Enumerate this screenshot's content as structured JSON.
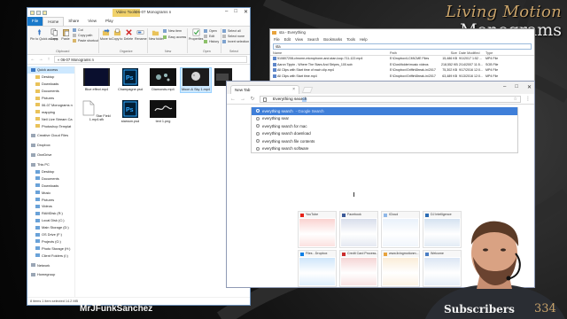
{
  "brand": {
    "top": "Living Motion",
    "bottom": "Monograms"
  },
  "overlay": {
    "channel": "MrJFunkSanchez",
    "subscribers_label": "Subscribers",
    "subscribers_count": "334"
  },
  "explorer": {
    "tool_tab": "Video Tools",
    "title": "06-07 Monograms n",
    "menu": [
      "File",
      "Home",
      "Share",
      "View",
      "Play"
    ],
    "ribbon": {
      "cut": "Cut",
      "copy_path": "Copy path",
      "paste_shortcut": "Paste shortcut",
      "pin": "Pin to Quick access",
      "copy": "Copy",
      "paste": "Paste",
      "move_to": "Move to",
      "copy_to": "Copy to",
      "delete": "Delete",
      "rename": "Rename",
      "new_folder": "New folder",
      "new_item": "New item",
      "easy_access": "Easy access",
      "properties": "Properties",
      "open": "Open",
      "edit": "Edit",
      "history": "History",
      "select_all": "Select all",
      "select_none": "Select none",
      "invert_selection": "Invert selection",
      "groups": [
        "Clipboard",
        "Organize",
        "New",
        "Open",
        "Select"
      ]
    },
    "address": "« 06-07 Monograms n",
    "nav": [
      {
        "label": "Quick access",
        "indent": false,
        "selected": true
      },
      {
        "label": "Desktop",
        "indent": true
      },
      {
        "label": "Downloads",
        "indent": true
      },
      {
        "label": "Documents",
        "indent": true
      },
      {
        "label": "Pictures",
        "indent": true
      },
      {
        "label": "06-07 Monograms n",
        "indent": true
      },
      {
        "label": "mapping",
        "indent": true
      },
      {
        "label": "Neil Live Stream Ca",
        "indent": true
      },
      {
        "label": "Photoshop Templat",
        "indent": true
      },
      {
        "label": "Creative Cloud Files",
        "indent": false,
        "gap": true
      },
      {
        "label": "Dropbox",
        "indent": false,
        "gap": true
      },
      {
        "label": "OneDrive",
        "indent": false,
        "gap": true
      },
      {
        "label": "This PC",
        "indent": false,
        "gap": true
      },
      {
        "label": "Desktop",
        "indent": true
      },
      {
        "label": "Documents",
        "indent": true
      },
      {
        "label": "Downloads",
        "indent": true
      },
      {
        "label": "Music",
        "indent": true
      },
      {
        "label": "Pictures",
        "indent": true
      },
      {
        "label": "Videos",
        "indent": true
      },
      {
        "label": "RAMDisk (R:)",
        "indent": true
      },
      {
        "label": "Local Disk (C:)",
        "indent": true
      },
      {
        "label": "Main Storage (D:)",
        "indent": true
      },
      {
        "label": "OS Drive (F:)",
        "indent": true
      },
      {
        "label": "Projects (G:)",
        "indent": true
      },
      {
        "label": "Photo Storage (H:)",
        "indent": true
      },
      {
        "label": "Client Folders (I:)",
        "indent": true
      },
      {
        "label": "Network",
        "indent": false,
        "gap": true
      },
      {
        "label": "Homegroup",
        "indent": false,
        "gap": true
      }
    ],
    "files": [
      {
        "name": "Blue effect.mp4",
        "kind": "video"
      },
      {
        "name": "Champagne.psd",
        "kind": "psd"
      },
      {
        "name": "Diamonds.mp4",
        "kind": "video"
      },
      {
        "name": "Moon & Sky 1.mp4",
        "kind": "video",
        "selected": true
      },
      {
        "name": "",
        "kind": "video-partial"
      },
      {
        "name": "Star Field 1.mp4.sfk",
        "kind": "doc"
      },
      {
        "name": "starssm.psd",
        "kind": "psd"
      },
      {
        "name": "text 1.png",
        "kind": "png"
      }
    ],
    "status": "8 items   1 item selected   14.2 MB"
  },
  "everything": {
    "title": "sta - Everything",
    "menu": [
      "File",
      "Edit",
      "View",
      "Search",
      "Bookmarks",
      "Tools",
      "Help"
    ],
    "search": "sta",
    "columns": [
      "Name",
      "Path",
      "Size",
      "Date Modified",
      "Type"
    ],
    "rows": [
      {
        "name": "510807208-chrome-microphone-and-stan-loop-711-122.mp4",
        "path": "E:\\Dropbox\\LCM\\CME Files",
        "size": "15,486 KB",
        "date": "9/1/2017 1:52 ...",
        "type": "MP4 File"
      },
      {
        "name": "Aaron Tippin - Where The Stars And Stripes_100.sob",
        "path": "E:\\Dost\\folder\\music videos",
        "size": "218,552 KB",
        "date": "2/14/2007 11:5...",
        "type": "SOB File"
      },
      {
        "name": "All Clips with Start time of each clip.mp4",
        "path": "E:\\Dropbox\\Griffin\\Break-in\\2017",
        "size": "75,302 KB",
        "date": "9/17/2016 12:0...",
        "type": "MP4 File"
      },
      {
        "name": "All Clips with Start time.mp4",
        "path": "E:\\Dropbox\\Griffin\\Break-in\\2017",
        "size": "63,489 KB",
        "date": "9/13/2016 12:0...",
        "type": "MP4 File"
      }
    ],
    "tooltip": "Quick access"
  },
  "chrome": {
    "tab_title": "New Tab",
    "omnibox_typed": "Everything sear",
    "omnibox_completion": "ch",
    "suggestions": [
      {
        "text": "everything search",
        "hint": " - Google Search",
        "bold_from": 15
      },
      {
        "text": "everything sear",
        "hint": ""
      },
      {
        "text": "everything search for mac",
        "hint": ""
      },
      {
        "text": "everything search download",
        "hint": ""
      },
      {
        "text": "everything search file contents",
        "hint": ""
      },
      {
        "text": "everything search software",
        "hint": ""
      }
    ],
    "tiles": [
      {
        "label": "YouTube",
        "color": "#e62117"
      },
      {
        "label": "Facebook",
        "color": "#3b5998"
      },
      {
        "label": "iCloud",
        "color": "#8fb7e8"
      },
      {
        "label": "DJ Intelligence",
        "color": "#2b6cb5"
      },
      {
        "label": "Files - Dropbox",
        "color": "#0d7fe6"
      },
      {
        "label": "Credit Card Process...",
        "color": "#cc2c2c"
      },
      {
        "label": "www.livingmotionm...",
        "color": "#e8a33d"
      },
      {
        "label": "Welcome",
        "color": "#4a7ec4"
      }
    ]
  },
  "colors": {
    "accent": "#1979ca",
    "gold": "#c9a36a",
    "highlight": "#3f7fd9"
  }
}
